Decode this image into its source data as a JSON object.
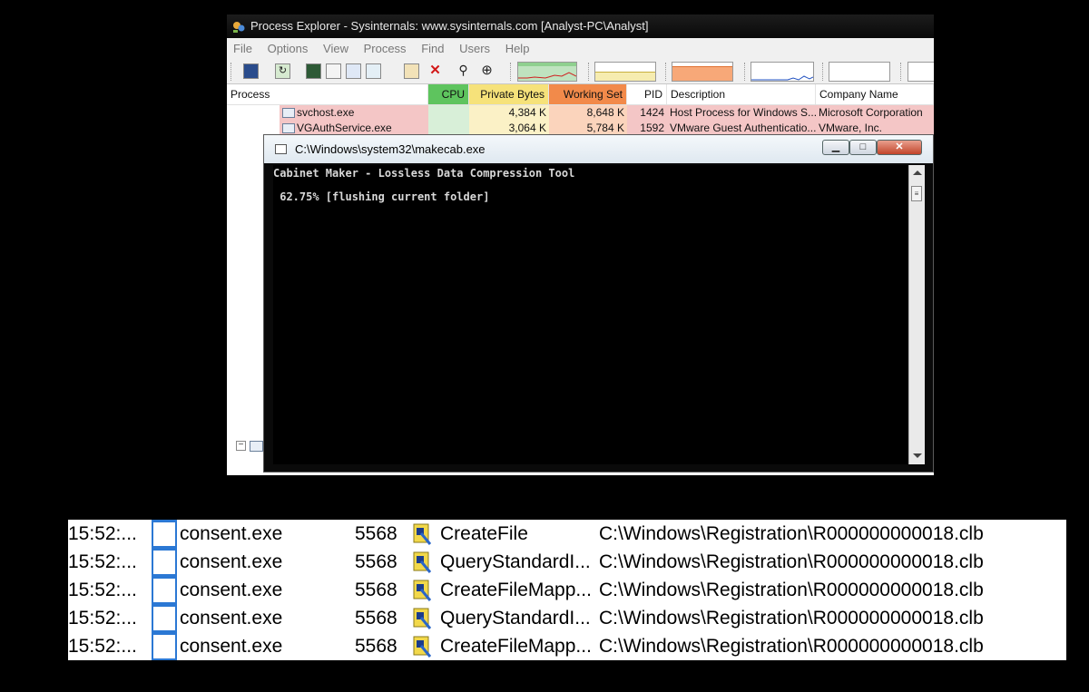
{
  "process_explorer": {
    "title": "Process Explorer - Sysinternals: www.sysinternals.com [Analyst-PC\\Analyst]",
    "menu": [
      "File",
      "Options",
      "View",
      "Process",
      "Find",
      "Users",
      "Help"
    ],
    "columns": {
      "process": "Process",
      "cpu": "CPU",
      "private_bytes": "Private Bytes",
      "working_set": "Working Set",
      "pid": "PID",
      "description": "Description",
      "company": "Company Name"
    },
    "rows": [
      {
        "name": "svchost.exe",
        "cpu": "",
        "private_bytes": "4,384 K",
        "working_set": "8,648 K",
        "pid": "1424",
        "description": "Host Process for Windows S...",
        "company": "Microsoft Corporation"
      },
      {
        "name": "VGAuthService.exe",
        "cpu": "",
        "private_bytes": "3,064 K",
        "working_set": "5,784 K",
        "pid": "1592",
        "description": "VMware Guest Authenticatio...",
        "company": "VMware, Inc."
      }
    ],
    "colors": {
      "cpu_header": "#5ec45e",
      "private_header": "#f6e27a",
      "working_header": "#f28a4a",
      "row_highlight": "#f4c6c6"
    }
  },
  "console": {
    "title": "C:\\Windows\\system32\\makecab.exe",
    "lines": [
      "Cabinet Maker - Lossless Data Compression Tool",
      " 62.75% [flushing current folder]"
    ]
  },
  "procmon": {
    "rows": [
      {
        "time": "15:52:...",
        "process": "consent.exe",
        "pid": "5568",
        "operation": "CreateFile",
        "path": "C:\\Windows\\Registration\\R000000000018.clb"
      },
      {
        "time": "15:52:...",
        "process": "consent.exe",
        "pid": "5568",
        "operation": "QueryStandardI...",
        "path": "C:\\Windows\\Registration\\R000000000018.clb"
      },
      {
        "time": "15:52:...",
        "process": "consent.exe",
        "pid": "5568",
        "operation": "CreateFileMapp...",
        "path": "C:\\Windows\\Registration\\R000000000018.clb"
      },
      {
        "time": "15:52:...",
        "process": "consent.exe",
        "pid": "5568",
        "operation": "QueryStandardI...",
        "path": "C:\\Windows\\Registration\\R000000000018.clb"
      },
      {
        "time": "15:52:...",
        "process": "consent.exe",
        "pid": "5568",
        "operation": "CreateFileMapp...",
        "path": "C:\\Windows\\Registration\\R000000000018.clb"
      }
    ]
  }
}
